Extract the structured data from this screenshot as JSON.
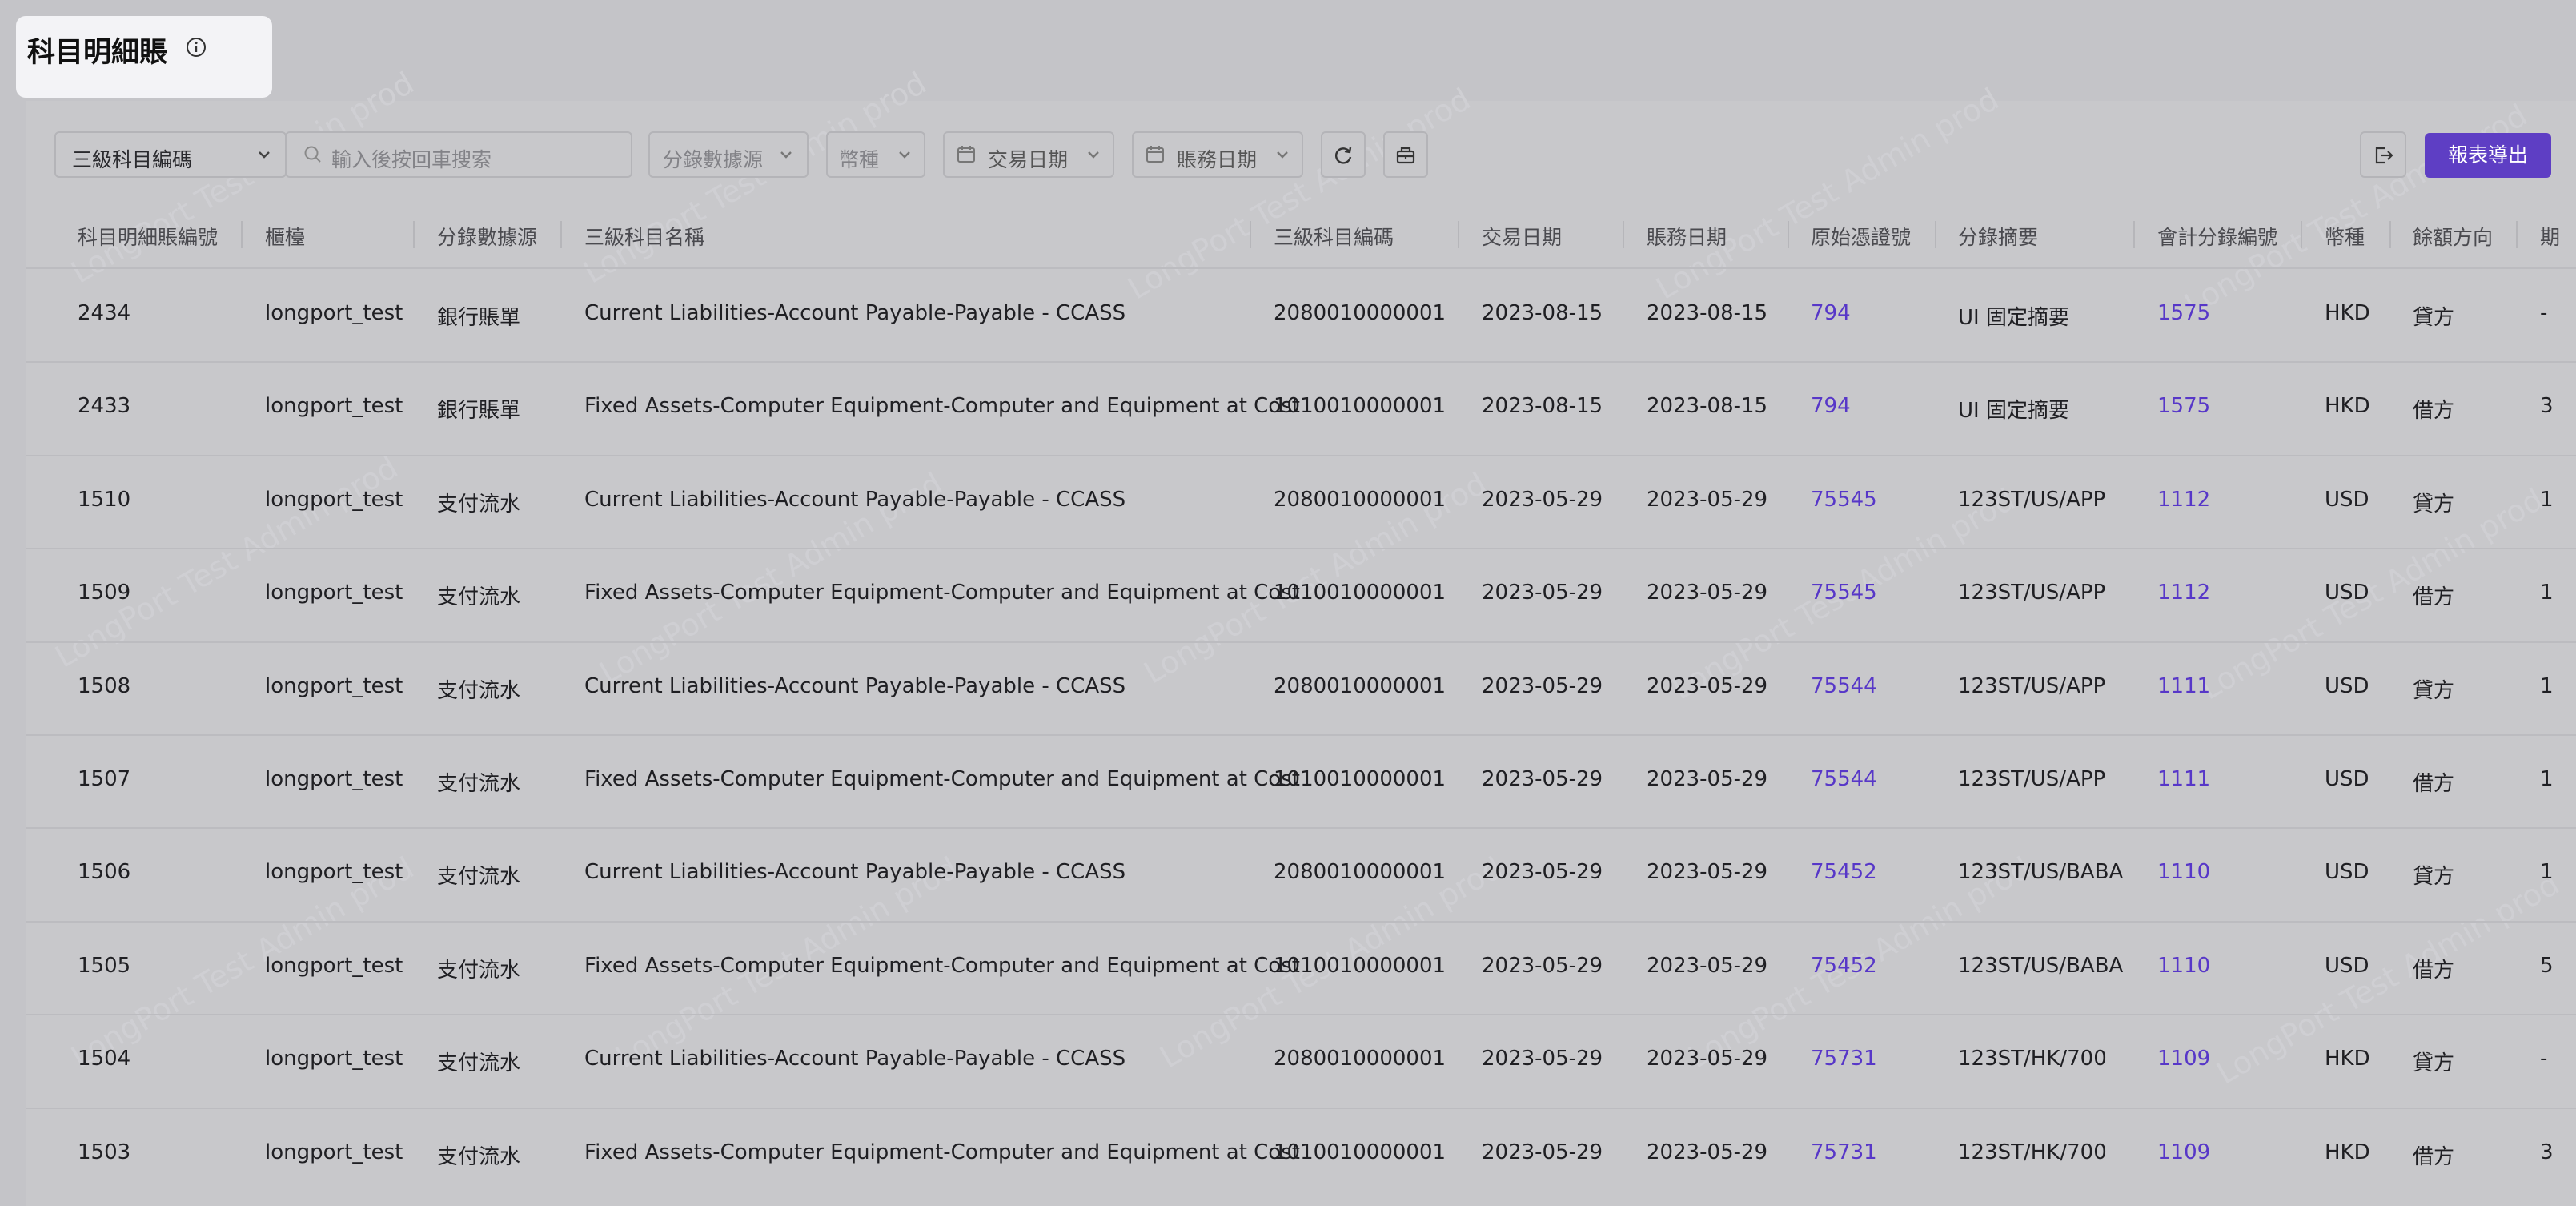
{
  "page": {
    "title": "科目明細賬"
  },
  "watermark": "LongPort Test Admin prod",
  "toolbar": {
    "account_select_value": "三級科目編碼",
    "search_placeholder": "輸入後按回車搜索",
    "source_filter": "分錄數據源",
    "currency_filter": "幣種",
    "trade_date_filter": "交易日期",
    "ledger_date_filter": "賬務日期",
    "export_label": "報表導出"
  },
  "table": {
    "columns": [
      "科目明細賬編號",
      "櫃檯",
      "分錄數據源",
      "三級科目名稱",
      "三級科目編碼",
      "交易日期",
      "賬務日期",
      "原始憑證號",
      "分錄摘要",
      "會計分錄編號",
      "幣種",
      "餘額方向",
      "期"
    ],
    "rows": [
      {
        "id": "2434",
        "counter": "longport_test",
        "source": "銀行賬單",
        "account_name": "Current Liabilities-Account Payable-Payable - CCASS",
        "account_code": "2080010000001",
        "trade_date": "2023-08-15",
        "ledger_date": "2023-08-15",
        "voucher": "794",
        "summary": "UI 固定摘要",
        "entry_no": "1575",
        "currency": "HKD",
        "direction": "貸方",
        "tail": "-"
      },
      {
        "id": "2433",
        "counter": "longport_test",
        "source": "銀行賬單",
        "account_name": "Fixed Assets-Computer Equipment-Computer and Equipment at Cost",
        "account_code": "1010010000001",
        "trade_date": "2023-08-15",
        "ledger_date": "2023-08-15",
        "voucher": "794",
        "summary": "UI 固定摘要",
        "entry_no": "1575",
        "currency": "HKD",
        "direction": "借方",
        "tail": "3"
      },
      {
        "id": "1510",
        "counter": "longport_test",
        "source": "支付流水",
        "account_name": "Current Liabilities-Account Payable-Payable - CCASS",
        "account_code": "2080010000001",
        "trade_date": "2023-05-29",
        "ledger_date": "2023-05-29",
        "voucher": "75545",
        "summary": "123ST/US/APP",
        "entry_no": "1112",
        "currency": "USD",
        "direction": "貸方",
        "tail": "1"
      },
      {
        "id": "1509",
        "counter": "longport_test",
        "source": "支付流水",
        "account_name": "Fixed Assets-Computer Equipment-Computer and Equipment at Cost",
        "account_code": "1010010000001",
        "trade_date": "2023-05-29",
        "ledger_date": "2023-05-29",
        "voucher": "75545",
        "summary": "123ST/US/APP",
        "entry_no": "1112",
        "currency": "USD",
        "direction": "借方",
        "tail": "1"
      },
      {
        "id": "1508",
        "counter": "longport_test",
        "source": "支付流水",
        "account_name": "Current Liabilities-Account Payable-Payable - CCASS",
        "account_code": "2080010000001",
        "trade_date": "2023-05-29",
        "ledger_date": "2023-05-29",
        "voucher": "75544",
        "summary": "123ST/US/APP",
        "entry_no": "1111",
        "currency": "USD",
        "direction": "貸方",
        "tail": "1"
      },
      {
        "id": "1507",
        "counter": "longport_test",
        "source": "支付流水",
        "account_name": "Fixed Assets-Computer Equipment-Computer and Equipment at Cost",
        "account_code": "1010010000001",
        "trade_date": "2023-05-29",
        "ledger_date": "2023-05-29",
        "voucher": "75544",
        "summary": "123ST/US/APP",
        "entry_no": "1111",
        "currency": "USD",
        "direction": "借方",
        "tail": "1"
      },
      {
        "id": "1506",
        "counter": "longport_test",
        "source": "支付流水",
        "account_name": "Current Liabilities-Account Payable-Payable - CCASS",
        "account_code": "2080010000001",
        "trade_date": "2023-05-29",
        "ledger_date": "2023-05-29",
        "voucher": "75452",
        "summary": "123ST/US/BABA",
        "entry_no": "1110",
        "currency": "USD",
        "direction": "貸方",
        "tail": "1"
      },
      {
        "id": "1505",
        "counter": "longport_test",
        "source": "支付流水",
        "account_name": "Fixed Assets-Computer Equipment-Computer and Equipment at Cost",
        "account_code": "1010010000001",
        "trade_date": "2023-05-29",
        "ledger_date": "2023-05-29",
        "voucher": "75452",
        "summary": "123ST/US/BABA",
        "entry_no": "1110",
        "currency": "USD",
        "direction": "借方",
        "tail": "5"
      },
      {
        "id": "1504",
        "counter": "longport_test",
        "source": "支付流水",
        "account_name": "Current Liabilities-Account Payable-Payable - CCASS",
        "account_code": "2080010000001",
        "trade_date": "2023-05-29",
        "ledger_date": "2023-05-29",
        "voucher": "75731",
        "summary": "123ST/HK/700",
        "entry_no": "1109",
        "currency": "HKD",
        "direction": "貸方",
        "tail": "-"
      },
      {
        "id": "1503",
        "counter": "longport_test",
        "source": "支付流水",
        "account_name": "Fixed Assets-Computer Equipment-Computer and Equipment at Cost",
        "account_code": "1010010000001",
        "trade_date": "2023-05-29",
        "ledger_date": "2023-05-29",
        "voucher": "75731",
        "summary": "123ST/HK/700",
        "entry_no": "1109",
        "currency": "HKD",
        "direction": "借方",
        "tail": "3"
      }
    ]
  },
  "colors": {
    "accent": "#5e3ec4",
    "link": "#5737c8",
    "overlay": "#c8c8cb"
  },
  "icons": {
    "info": "info-circle-icon",
    "search": "search-icon",
    "calendar": "calendar-icon",
    "refresh": "refresh-icon",
    "column_settings": "column-settings-icon",
    "exit": "export-exit-icon",
    "chevron": "chevron-down-icon"
  }
}
